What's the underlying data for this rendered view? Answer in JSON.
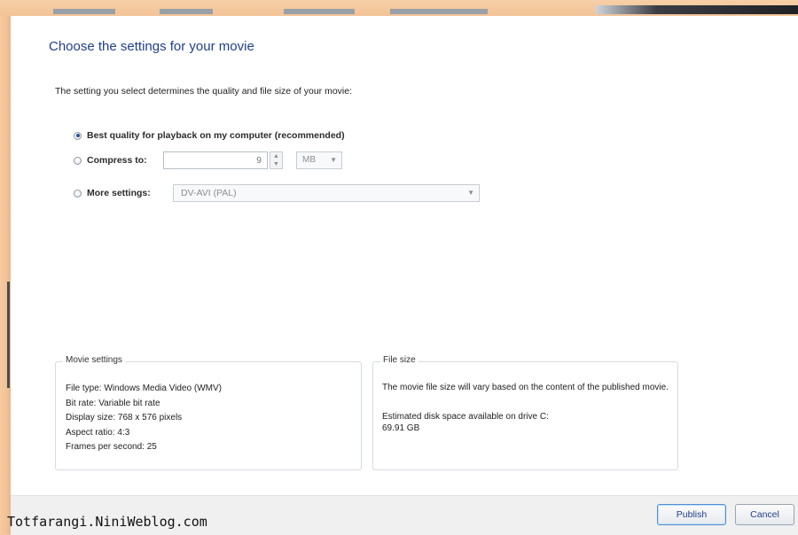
{
  "dialog": {
    "title": "Choose the settings for your movie",
    "description": "The setting you select determines the quality and file size of your movie:"
  },
  "options": {
    "best_quality": {
      "label": "Best quality for playback on my computer (recommended)",
      "selected": true
    },
    "compress": {
      "label": "Compress to:",
      "value": "9",
      "unit": "MB",
      "selected": false
    },
    "more_settings": {
      "label": "More settings:",
      "value": "DV-AVI (PAL)",
      "selected": false
    }
  },
  "movie_settings": {
    "title": "Movie settings",
    "file_type": "File type: Windows Media Video (WMV)",
    "bit_rate": "Bit rate: Variable bit rate",
    "display_size": "Display size: 768 x 576 pixels",
    "aspect_ratio": "Aspect ratio: 4:3",
    "fps": "Frames per second: 25"
  },
  "file_size": {
    "title": "File size",
    "note": "The movie file size will vary based on the content of the published movie.",
    "disk_label": "Estimated disk space available on drive C:",
    "disk_value": "69.91 GB"
  },
  "footer": {
    "watermark": "Totfarangi.NiniWeblog.com",
    "publish": "Publish",
    "cancel": "Cancel"
  },
  "icons": {
    "spinner_up": "▲",
    "spinner_down": "▼",
    "dropdown": "▼"
  }
}
